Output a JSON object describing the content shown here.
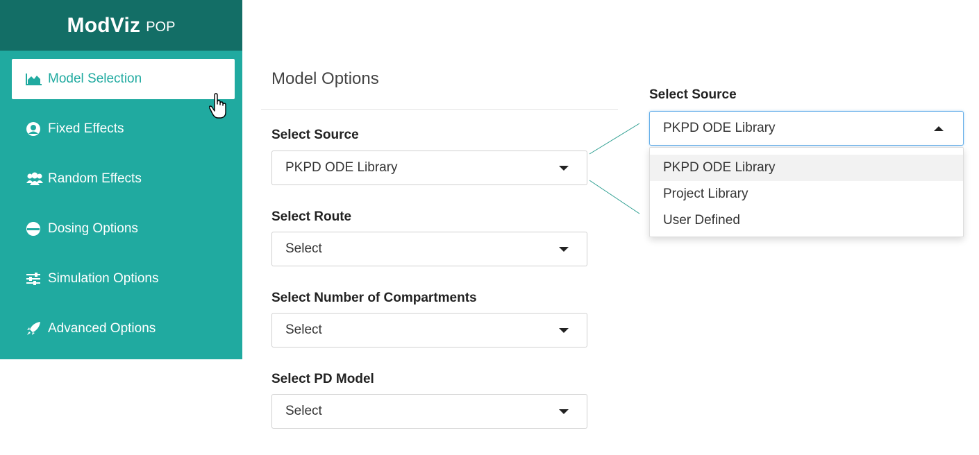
{
  "brand": {
    "name": "ModViz",
    "suffix": "POP"
  },
  "sidebar": {
    "items": [
      {
        "label": "Model Selection",
        "icon": "area-chart-icon",
        "active": true
      },
      {
        "label": "Fixed Effects",
        "icon": "user-circle-icon"
      },
      {
        "label": "Random Effects",
        "icon": "users-icon"
      },
      {
        "label": "Dosing Options",
        "icon": "half-circle-icon"
      },
      {
        "label": "Simulation Options",
        "icon": "sliders-icon"
      },
      {
        "label": "Advanced Options",
        "icon": "rocket-icon"
      }
    ]
  },
  "main": {
    "title": "Model Options",
    "fields": [
      {
        "label": "Select Source",
        "value": "PKPD ODE Library"
      },
      {
        "label": "Select Route",
        "value": "Select"
      },
      {
        "label": "Select Number of Compartments",
        "value": "Select"
      },
      {
        "label": "Select PD Model",
        "value": "Select"
      }
    ]
  },
  "zoom": {
    "label": "Select Source",
    "value": "PKPD ODE Library",
    "options": [
      "PKPD ODE Library",
      "Project Library",
      "User Defined"
    ]
  },
  "colors": {
    "sidebar": "#20aaa0",
    "brand_bg": "#136e66",
    "accent": "#20aaa0"
  }
}
